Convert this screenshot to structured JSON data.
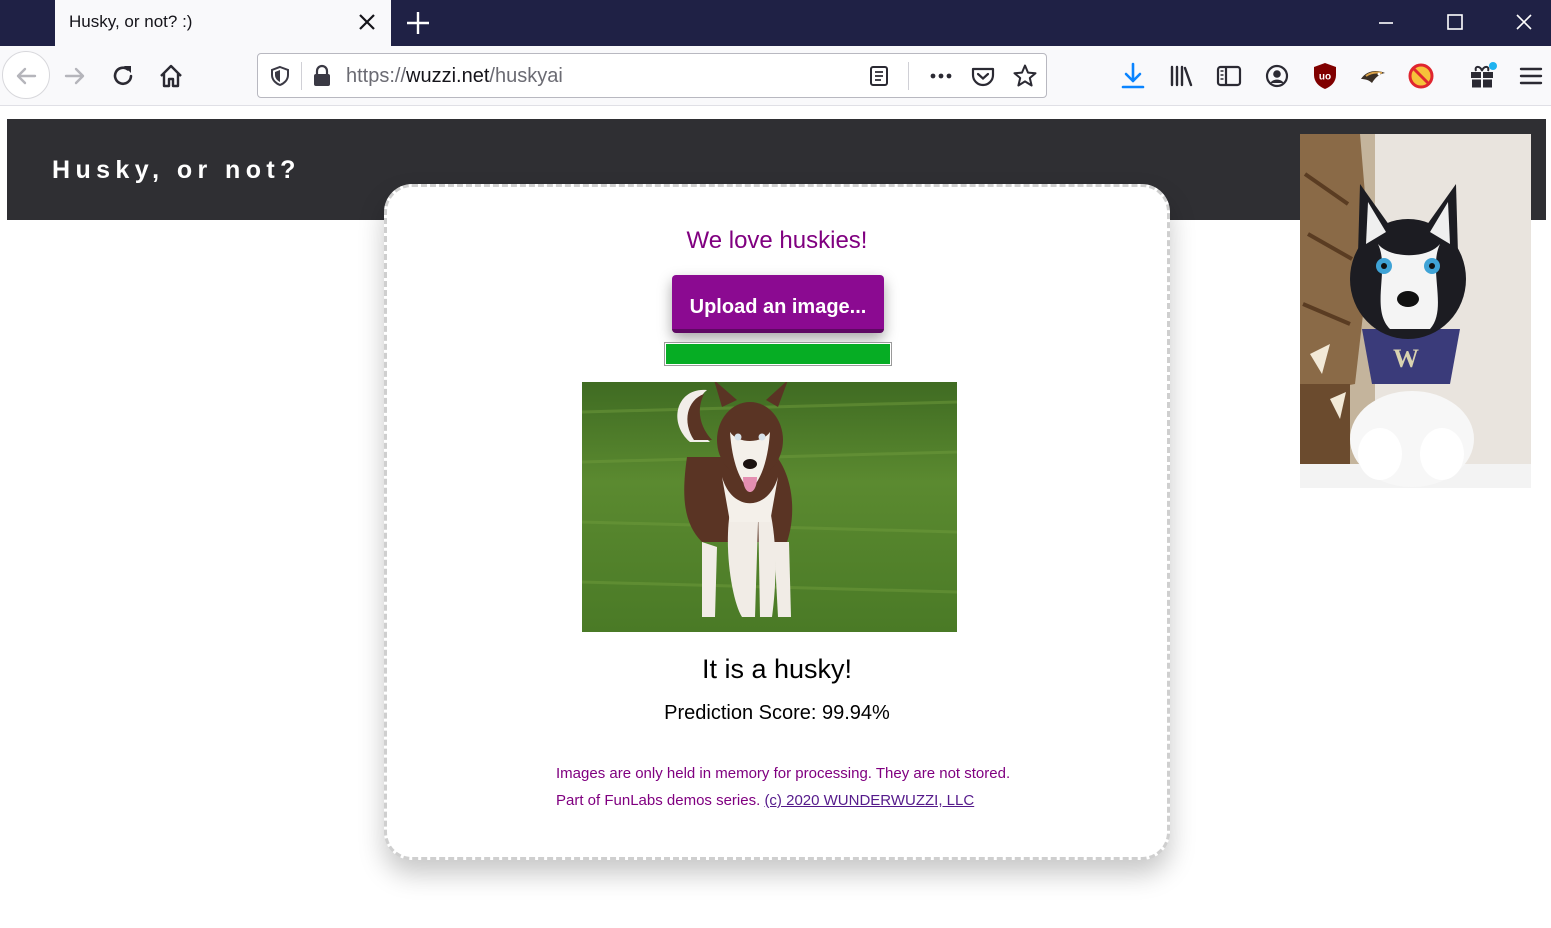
{
  "browser": {
    "tab_title": "Husky, or not? :)",
    "url_scheme": "https://",
    "url_host": "wuzzi.net",
    "url_path": "/huskyai"
  },
  "header": {
    "title": "Husky, or not?"
  },
  "card": {
    "tagline": "We love huskies!",
    "upload_label": "Upload an image...",
    "progress_fraction": 1.0,
    "result": "It is a husky!",
    "score": "Prediction Score: 99.94%",
    "note": "Images are only held in memory for processing. They are not stored.",
    "footer_text": "Part of FunLabs demos series. ",
    "footer_link": "(c) 2020 WUNDERWUZZI, LLC"
  },
  "colors": {
    "accent_purple": "#800080",
    "button_purple": "#8b0a91",
    "progress_green": "#06ad24",
    "header_dark": "#2f2f33",
    "tabbar_navy": "#1f2145"
  },
  "icons": {
    "toolbar": [
      "back-icon",
      "forward-icon",
      "reload-icon",
      "home-icon",
      "shield-icon",
      "lock-icon",
      "reader-view-icon",
      "more-icon",
      "pocket-icon",
      "bookmark-star-icon",
      "download-icon",
      "library-icon",
      "sidebar-icon",
      "account-icon",
      "ublock-icon",
      "extension-bird-icon",
      "no-tracking-icon",
      "gift-icon",
      "menu-icon"
    ]
  }
}
